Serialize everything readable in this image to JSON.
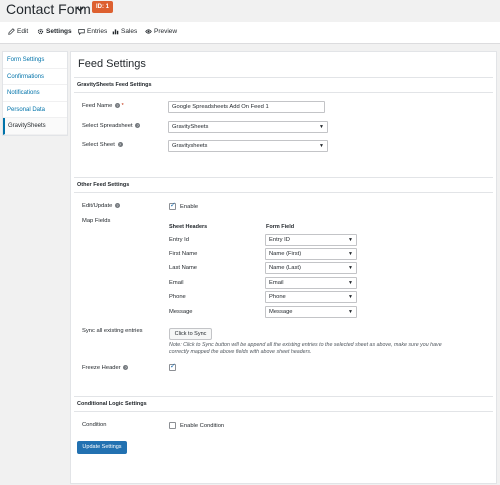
{
  "header": {
    "title": "Contact Form",
    "id_badge": "ID: 1"
  },
  "tabs": [
    {
      "label": "Edit",
      "icon": "pencil-icon"
    },
    {
      "label": "Settings",
      "icon": "gear-icon"
    },
    {
      "label": "Entries",
      "icon": "comment-icon"
    },
    {
      "label": "Sales",
      "icon": "bar-chart-icon"
    },
    {
      "label": "Preview",
      "icon": "eye-icon"
    }
  ],
  "sidebar": {
    "items": [
      {
        "label": "Form Settings"
      },
      {
        "label": "Confirmations"
      },
      {
        "label": "Notifications"
      },
      {
        "label": "Personal Data"
      },
      {
        "label": "GravitySheets"
      }
    ]
  },
  "main": {
    "title": "Feed Settings",
    "section1": {
      "heading": "GravitySheets Feed Settings",
      "feed_name_label": "Feed Name",
      "feed_name_value": "Google Spreadsheets Add On Feed 1",
      "spreadsheet_label": "Select Spreadsheet",
      "spreadsheet_value": "GravitySheets",
      "sheet_label": "Select Sheet",
      "sheet_value": "Gravitysheets"
    },
    "section2": {
      "heading": "Other Feed Settings",
      "edit_update_label": "Edit/Update",
      "enable_label": "Enable",
      "map_fields_label": "Map Fields",
      "col_sheet_headers": "Sheet Headers",
      "col_form_field": "Form Field",
      "rows": [
        {
          "header": "Entry Id",
          "field": "Entry ID"
        },
        {
          "header": "First Name",
          "field": "Name (First)"
        },
        {
          "header": "Last Name",
          "field": "Name (Last)"
        },
        {
          "header": "Email",
          "field": "Email"
        },
        {
          "header": "Phone",
          "field": "Phone"
        },
        {
          "header": "Message",
          "field": "Message"
        }
      ],
      "sync_label": "Sync all existing entries",
      "sync_button": "Click to Sync",
      "sync_note_1": "Note: Click to Sync button will be append all the existing entries to the selected sheet as above, make sure you have",
      "sync_note_2": "correctly mapped the above fields with above sheet headers.",
      "freeze_label": "Freeze Header"
    },
    "section3": {
      "heading": "Conditional Logic Settings",
      "condition_label": "Condition",
      "enable_condition_label": "Enable Condition"
    },
    "update_button": "Update Settings"
  },
  "colors": {
    "accent": "#2271b1",
    "badge": "#dd6030",
    "link": "#0073aa"
  }
}
